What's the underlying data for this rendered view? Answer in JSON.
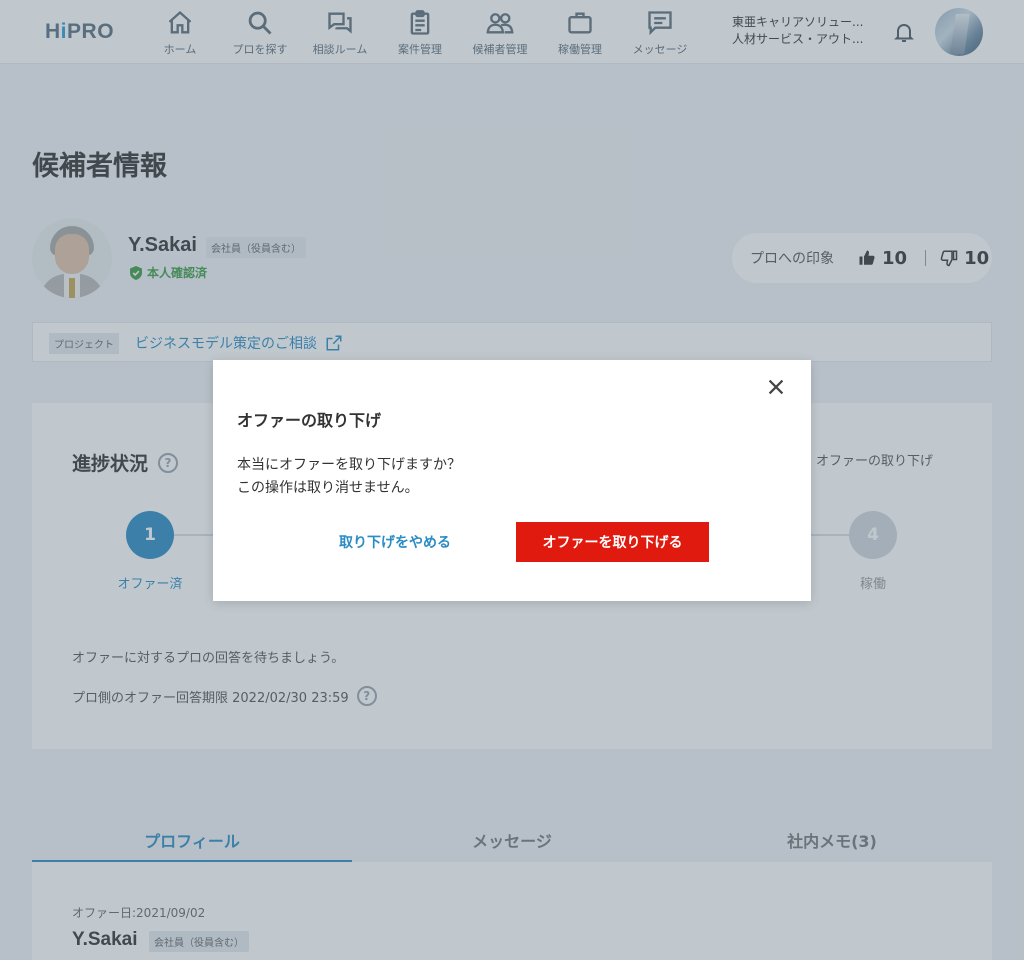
{
  "header": {
    "logo_prefix": "H",
    "logo_i": "i",
    "logo_suffix": "PRO",
    "nav": [
      {
        "label": "ホーム",
        "icon": "home-icon"
      },
      {
        "label": "プロを探す",
        "icon": "search-icon"
      },
      {
        "label": "相談ルーム",
        "icon": "chat-icon"
      },
      {
        "label": "案件管理",
        "icon": "clipboard-icon"
      },
      {
        "label": "候補者管理",
        "icon": "people-icon"
      },
      {
        "label": "稼働管理",
        "icon": "briefcase-icon"
      },
      {
        "label": "メッセージ",
        "icon": "message-icon"
      }
    ],
    "company_line1": "東亜キャリアソリュー...",
    "company_line2": "人材サービス・アウト..."
  },
  "page": {
    "title": "候補者情報"
  },
  "candidate": {
    "name": "Y.Sakai",
    "member_tag": "会社員（役員含む）",
    "verified_label": "本人確認済"
  },
  "impression": {
    "label": "プロへの印象",
    "likes": "10",
    "dislikes": "10"
  },
  "project": {
    "tag": "プロジェクト",
    "link": "ビジネスモデル策定のご相談"
  },
  "progress": {
    "title": "進捗状況",
    "withdraw_link": "オファーの取り下げ",
    "steps": [
      {
        "number": "1",
        "label": "オファー済"
      },
      {
        "number": "4",
        "label": "稼働"
      }
    ],
    "message": "オファーに対するプロの回答を待ちましょう。",
    "deadline": "プロ側のオファー回答期限 2022/02/30 23:59"
  },
  "tabs": [
    {
      "label": "プロフィール"
    },
    {
      "label": "メッセージ"
    },
    {
      "label": "社内メモ(3)"
    }
  ],
  "profile": {
    "offer_date": "オファー日:2021/09/02",
    "name": "Y.Sakai",
    "member_tag": "会社員（役員含む）"
  },
  "modal": {
    "title": "オファーの取り下げ",
    "line1": "本当にオファーを取り下げますか？",
    "line2": "この操作は取り消せません。",
    "cancel_label": "取り下げをやめる",
    "confirm_label": "オファーを取り下げる"
  },
  "colors": {
    "accent": "#2a8cc4",
    "danger": "#e11a0f",
    "verified": "#3c9b45"
  }
}
